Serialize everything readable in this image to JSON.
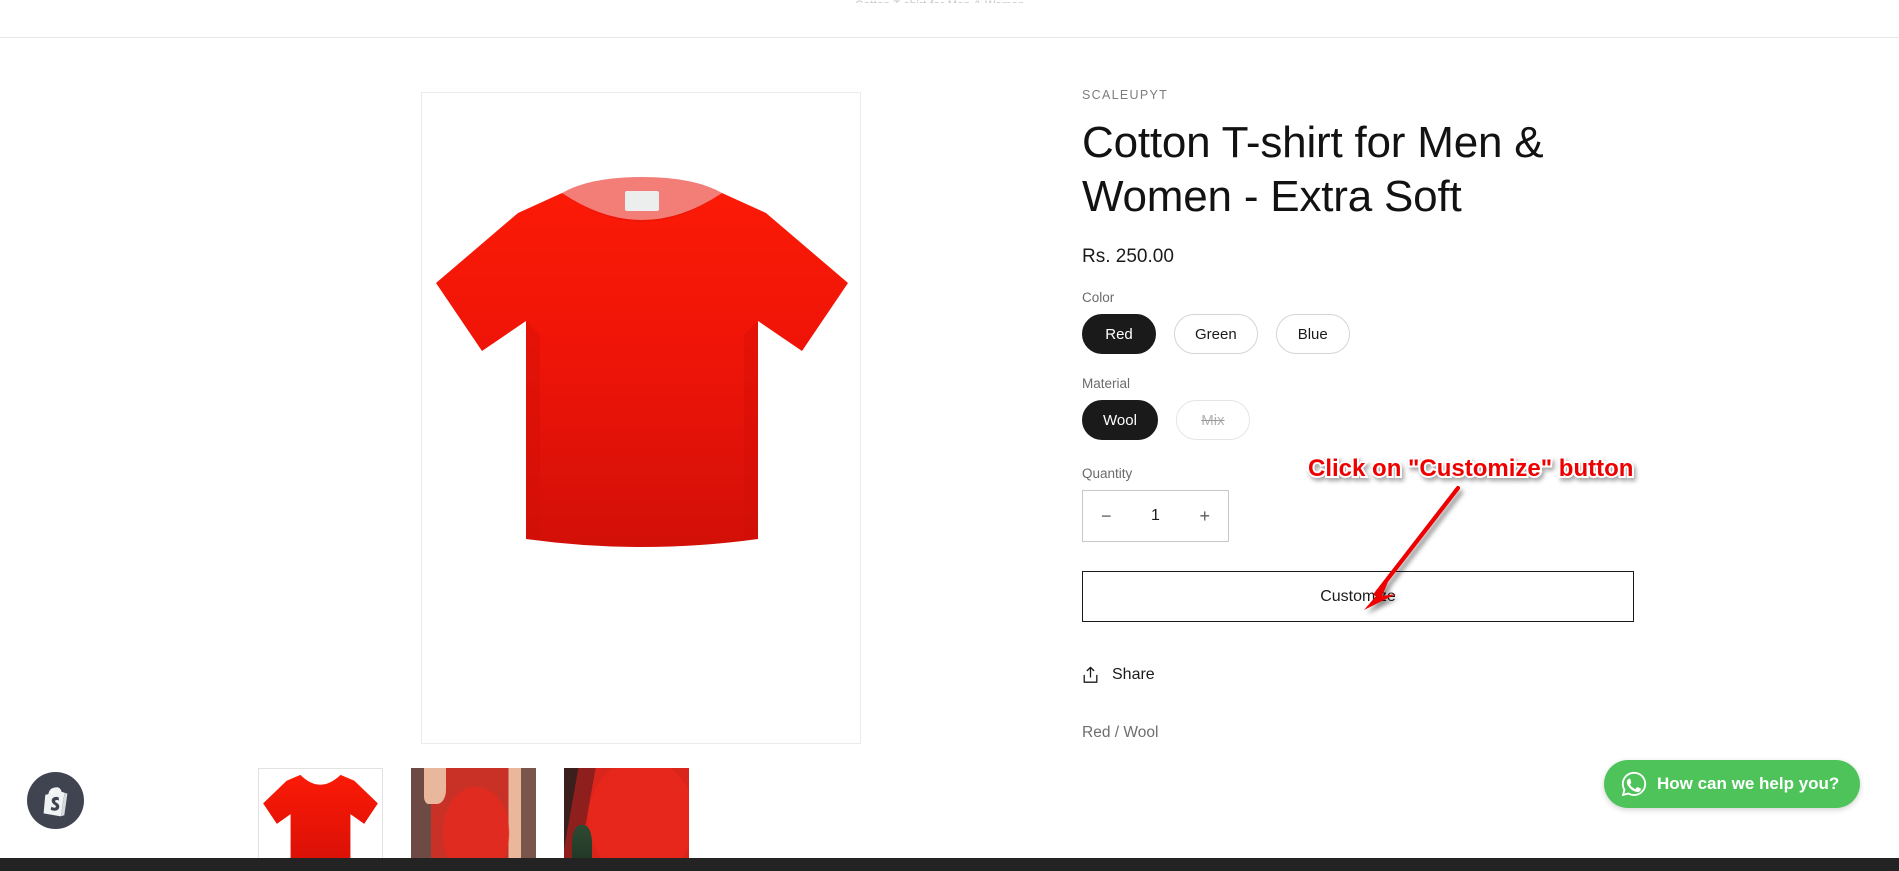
{
  "header": {
    "ghost_text": "Cotton T-shirt for Men & Women"
  },
  "gallery": {
    "main_image_alt": "Red cotton t-shirt front view",
    "thumbnails": [
      {
        "alt": "Red t-shirt flat lay",
        "selected": true
      },
      {
        "alt": "Person wearing red t-shirt against brick wall",
        "selected": false
      },
      {
        "alt": "Close-up of red t-shirt fabric",
        "selected": false
      }
    ]
  },
  "product": {
    "vendor": "SCALEUPYT",
    "title": "Cotton T-shirt for Men & Women - Extra Soft",
    "price": "Rs. 250.00",
    "variant_summary": "Red / Wool",
    "options": [
      {
        "label": "Color",
        "values": [
          {
            "label": "Red",
            "state": "selected"
          },
          {
            "label": "Green",
            "state": "available"
          },
          {
            "label": "Blue",
            "state": "available"
          }
        ]
      },
      {
        "label": "Material",
        "values": [
          {
            "label": "Wool",
            "state": "selected"
          },
          {
            "label": "Mix",
            "state": "unavailable"
          }
        ]
      }
    ],
    "quantity": {
      "label": "Quantity",
      "value": "1",
      "decrease_label": "−",
      "increase_label": "+"
    },
    "customize_label": "Customize",
    "share_label": "Share",
    "share_icon": "share-upload-icon"
  },
  "annotation": {
    "text": "Click on \"Customize\" button",
    "color": "#ee0000",
    "arrow": "red-arrow-down-left"
  },
  "shopify_badge": {
    "icon": "shopify-bag-icon",
    "background": "#3f4450"
  },
  "whatsapp": {
    "text": "How can we help you?",
    "icon": "whatsapp-icon",
    "background": "#4dc35a"
  }
}
